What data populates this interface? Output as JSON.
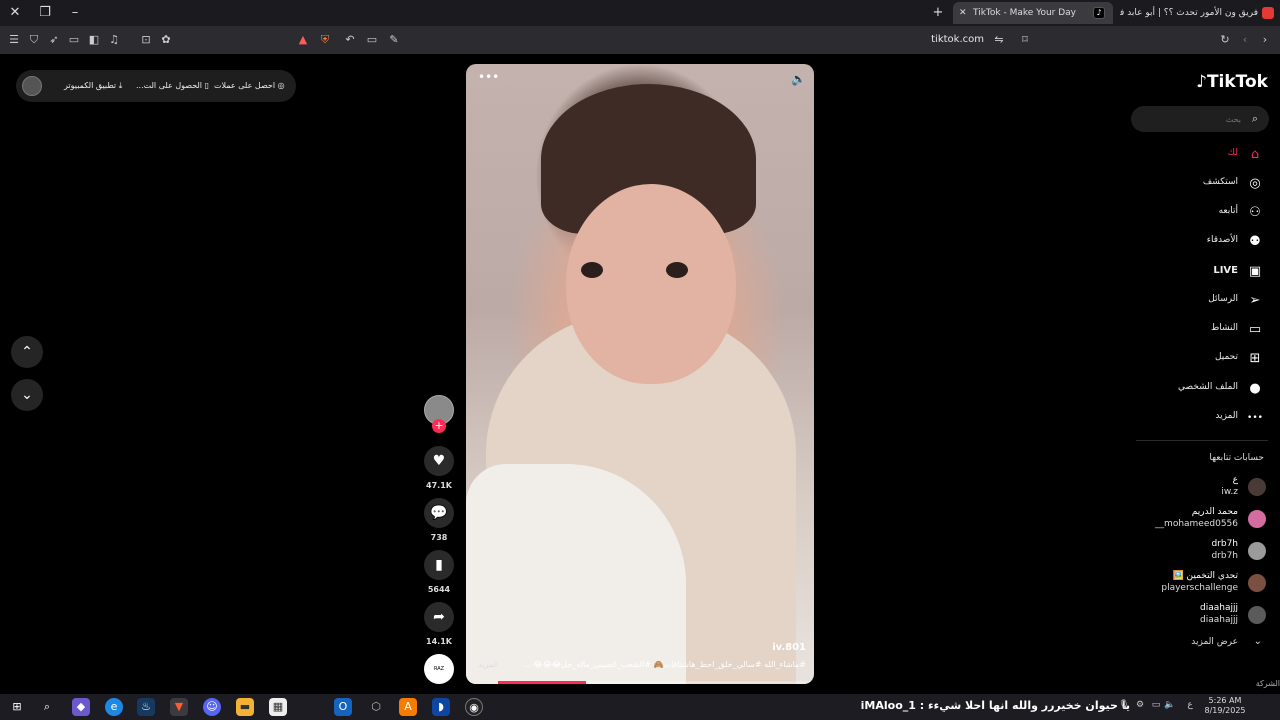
{
  "browser": {
    "tabs": [
      {
        "title": "TikTok - Make Your Day",
        "active": true
      },
      {
        "title": "فريق ون الأمور تحدث ؟؟ | أبو عابد في",
        "active": false
      }
    ],
    "url": "tiktok.com"
  },
  "top_bar": {
    "get_coins": "احصل على عملات",
    "get_app": "الحصول على الت...",
    "desktop_app": "تطبيق الكمبيوتر"
  },
  "video": {
    "author": "iv.801",
    "caption": "#ماشاء_الله #سالي_خلق_احط_هاشتاقات🙈 #الشعب_الصيني_ماله_حل😂😂😂 ...",
    "more": "المزيد",
    "progress": 0.28
  },
  "actions": {
    "likes": "47.1K",
    "comments": "738",
    "saves": "5644",
    "shares": "14.1K",
    "music_label": "RAZ"
  },
  "sidebar": {
    "logo": "TikTok",
    "search_placeholder": "بحث",
    "nav": [
      {
        "label": "لك",
        "icon": "home-icon",
        "active": true
      },
      {
        "label": "استكشف",
        "icon": "explore-icon",
        "active": false
      },
      {
        "label": "أتابعه",
        "icon": "following-icon",
        "active": false
      },
      {
        "label": "الأصدقاء",
        "icon": "friends-icon",
        "active": false
      },
      {
        "label": "LIVE",
        "icon": "live-icon",
        "active": false
      },
      {
        "label": "الرسائل",
        "icon": "messages-icon",
        "active": false
      },
      {
        "label": "النشاط",
        "icon": "activity-icon",
        "active": false
      },
      {
        "label": "تحميل",
        "icon": "upload-icon",
        "active": false
      },
      {
        "label": "الملف الشخصي",
        "icon": "profile-icon",
        "active": false
      },
      {
        "label": "المزيد",
        "icon": "more-icon",
        "active": false
      }
    ],
    "following_title": "حسابات تتابعها",
    "following": [
      {
        "name": "ع",
        "handle": "iw.z"
      },
      {
        "name": "محمد الدريم",
        "handle": "__mohameed0556"
      },
      {
        "name": "drb7h",
        "handle": "drb7h"
      },
      {
        "name": "تحدي التخمين 🖼️",
        "handle": "playerschallenge"
      },
      {
        "name": "diaahajjj",
        "handle": "diaahajjj"
      }
    ],
    "see_more": "عرض المزيد",
    "company": "الشركة"
  },
  "taskbar": {
    "ticker": "يا حيوان خخيررر والله انها احلا شيءء : iMAloo_1",
    "time": "5:26 AM",
    "date": "8/19/2025"
  },
  "colors": {
    "accent": "#fe2c55",
    "background": "#000000",
    "tab_active": "#3a3a3f"
  }
}
